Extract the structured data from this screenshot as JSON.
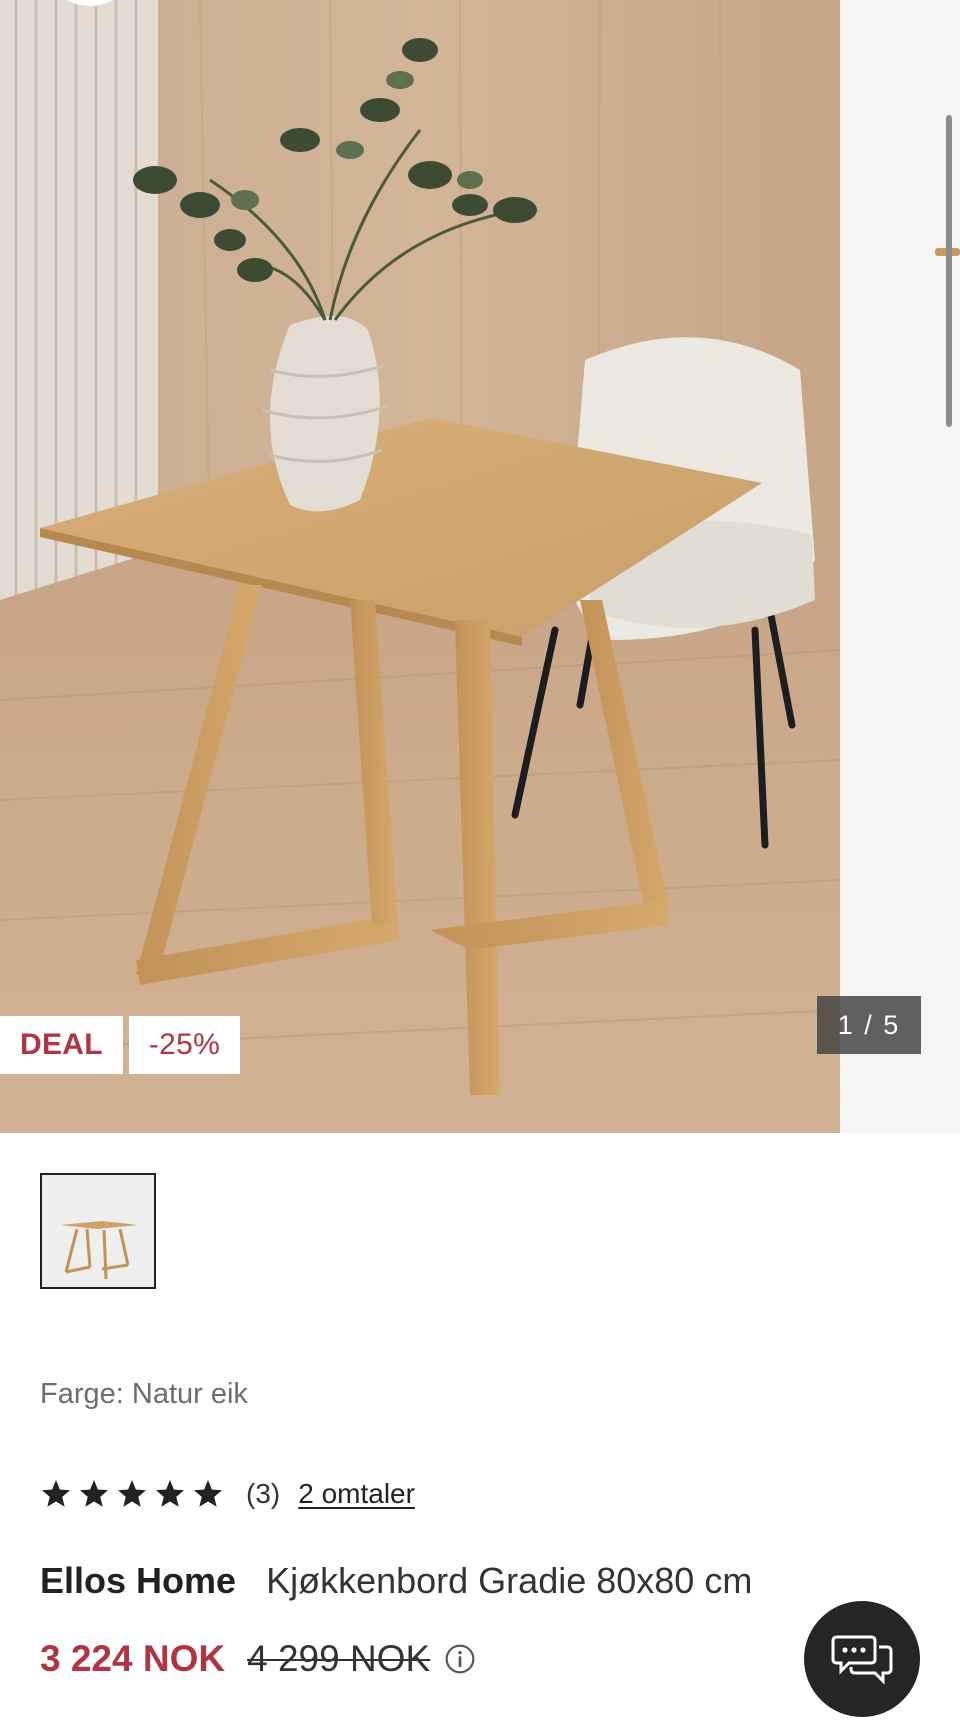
{
  "gallery": {
    "badges": {
      "deal": "DEAL",
      "discount": "-25%"
    },
    "counter": "1 / 5"
  },
  "product": {
    "color_label": "Farge:",
    "color_value": "Natur eik",
    "rating_stars": 5,
    "rating_count": "(3)",
    "reviews_link": "2 omtaler",
    "brand": "Ellos Home",
    "name": "Kjøkkenbord Gradie 80x80 cm",
    "price": "3 224 NOK",
    "old_price": "4 299 NOK"
  },
  "colors": {
    "sale_red": "#b03442",
    "text_dark": "#222222",
    "muted_grey": "#6d6d6d",
    "chat_button": "#252525"
  },
  "icons": [
    "star-icon",
    "info-icon",
    "chat-icon"
  ]
}
